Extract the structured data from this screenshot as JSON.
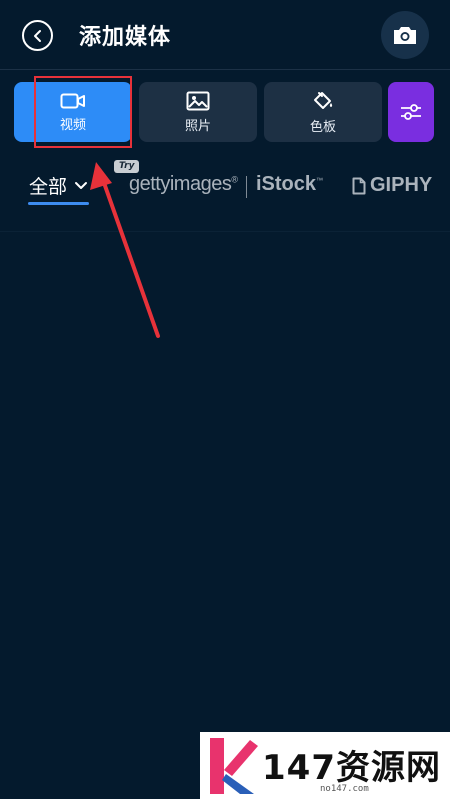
{
  "header": {
    "title": "添加媒体",
    "back_icon": "chevron-left-icon",
    "camera_icon": "camera-icon"
  },
  "tabs": [
    {
      "label": "视频",
      "icon": "video-icon",
      "active": true
    },
    {
      "label": "照片",
      "icon": "image-icon",
      "active": false
    },
    {
      "label": "色板",
      "icon": "paint-bucket-icon",
      "active": false
    }
  ],
  "filter_icon": "sliders-icon",
  "sources": {
    "all_label": "全部",
    "try_badge": "Try",
    "getty": "gettyimages",
    "getty_reg": "®",
    "istock": "iStock",
    "istock_tm": "™",
    "giphy": "GIPHY"
  },
  "watermark": {
    "text": "147资源网",
    "url": "no147.com"
  },
  "colors": {
    "background": "#041a2d",
    "active_tab": "#2d8cf7",
    "tab": "#1d3044",
    "filter": "#7a2ee0",
    "annotation": "#e7323a",
    "underline": "#3d8cf0"
  }
}
